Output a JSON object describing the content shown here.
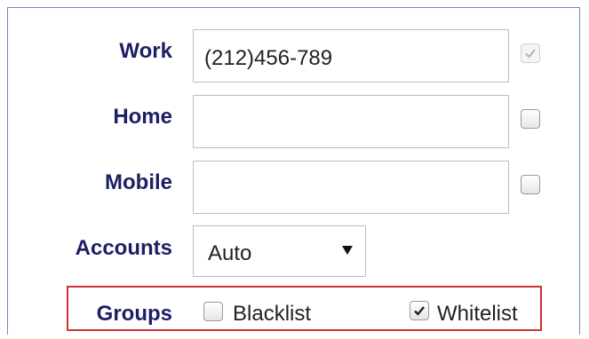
{
  "form": {
    "work": {
      "label": "Work",
      "value": "(212)456-789",
      "checkbox_checked": true,
      "checkbox_disabled": true
    },
    "home": {
      "label": "Home",
      "value": "",
      "checkbox_checked": false
    },
    "mobile": {
      "label": "Mobile",
      "value": "",
      "checkbox_checked": false
    },
    "accounts": {
      "label": "Accounts",
      "selected": "Auto"
    },
    "groups": {
      "label": "Groups",
      "blacklist": {
        "label": "Blacklist",
        "checked": false
      },
      "whitelist": {
        "label": "Whitelist",
        "checked": true
      }
    }
  },
  "colors": {
    "label": "#1d1f63",
    "highlight_border": "#d2302f",
    "panel_border": "#6d8bb5"
  },
  "icons": {
    "checkmark": "check-icon",
    "dropdown": "dropdown-caret-icon"
  }
}
